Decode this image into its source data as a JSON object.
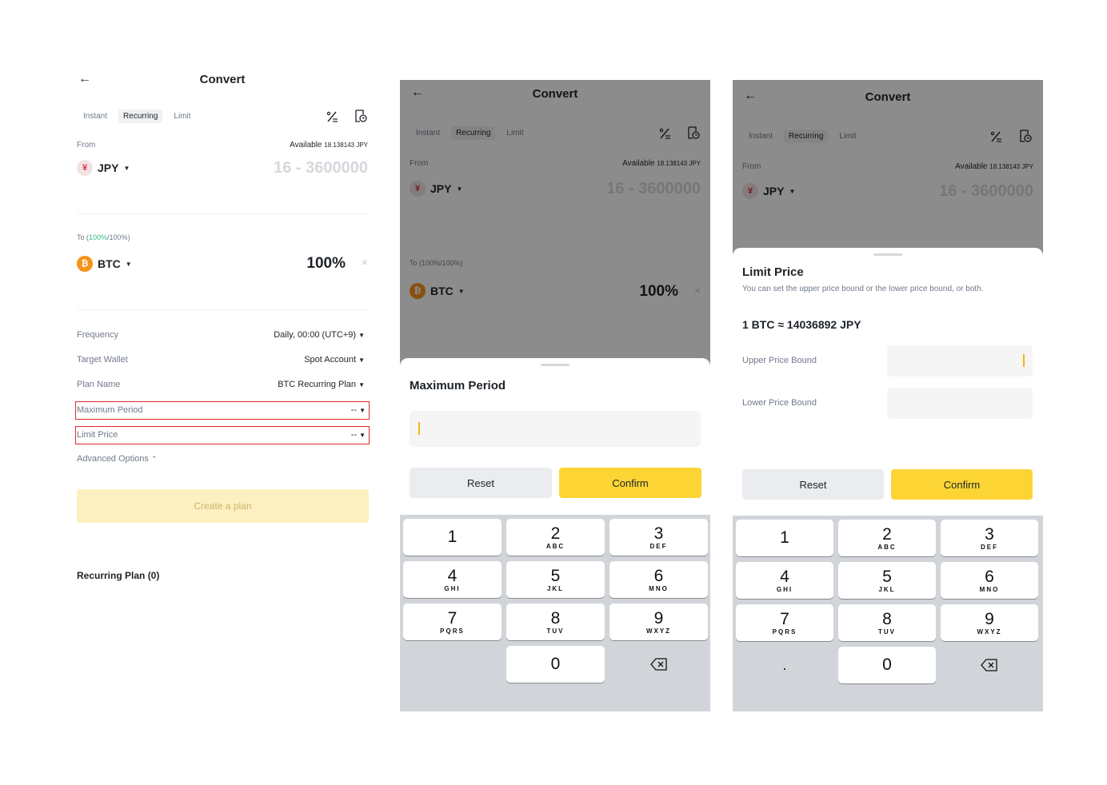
{
  "screen1": {
    "title": "Convert",
    "tabs": [
      "Instant",
      "Recurring",
      "Limit"
    ],
    "from_label": "From",
    "available_label": "Available",
    "available_value": "18.138143 JPY",
    "from_coin": "JPY",
    "from_placeholder": "16 - 3600000",
    "to_prefix": "To (",
    "to_pct": "100%",
    "to_suffix": "/100%)",
    "to_coin": "BTC",
    "to_value": "100%",
    "rows": [
      {
        "label": "Frequency",
        "value": "Daily, 00:00 (UTC+9)"
      },
      {
        "label": "Target Wallet",
        "value": "Spot Account"
      },
      {
        "label": "Plan Name",
        "value": "BTC Recurring Plan"
      },
      {
        "label": "Maximum Period",
        "value": "--"
      },
      {
        "label": "Limit Price",
        "value": "--"
      }
    ],
    "advanced": "Advanced Options",
    "create_button": "Create a plan",
    "recurring_plan": "Recurring Plan (0)"
  },
  "screen2": {
    "title": "Convert",
    "tabs": [
      "Instant",
      "Recurring",
      "Limit"
    ],
    "from_label": "From",
    "available_label": "Available",
    "available_value": "18.138143 JPY",
    "from_coin": "JPY",
    "from_placeholder": "16 - 3600000",
    "to_label": "To (100%/100%)",
    "to_coin": "BTC",
    "to_value": "100%",
    "sheet_title": "Maximum Period",
    "reset": "Reset",
    "confirm": "Confirm"
  },
  "screen3": {
    "title": "Convert",
    "tabs": [
      "Instant",
      "Recurring",
      "Limit"
    ],
    "from_label": "From",
    "available_label": "Available",
    "available_value": "18.138143 JPY",
    "from_coin": "JPY",
    "from_placeholder": "16 - 3600000",
    "sheet_title": "Limit Price",
    "sheet_sub": "You can set the upper price bound or the lower price bound, or both.",
    "rate": "1 BTC ≈ 14036892 JPY",
    "upper_label": "Upper Price Bound",
    "lower_label": "Lower Price Bound",
    "reset": "Reset",
    "confirm": "Confirm"
  },
  "keypad": {
    "keys": [
      {
        "num": "1",
        "letters": ""
      },
      {
        "num": "2",
        "letters": "ABC"
      },
      {
        "num": "3",
        "letters": "DEF"
      },
      {
        "num": "4",
        "letters": "GHI"
      },
      {
        "num": "5",
        "letters": "JKL"
      },
      {
        "num": "6",
        "letters": "MNO"
      },
      {
        "num": "7",
        "letters": "PQRS"
      },
      {
        "num": "8",
        "letters": "TUV"
      },
      {
        "num": "9",
        "letters": "WXYZ"
      }
    ],
    "zero": "0",
    "dot": "."
  },
  "icons": {
    "back": "arrow-left-icon",
    "fee": "percent-icon",
    "history": "history-doc-icon",
    "jpy": "yen-coin-icon",
    "btc": "bitcoin-coin-icon"
  },
  "colors": {
    "accent": "#fcd535",
    "highlight": "#e0292b",
    "green": "#2ebd85"
  }
}
